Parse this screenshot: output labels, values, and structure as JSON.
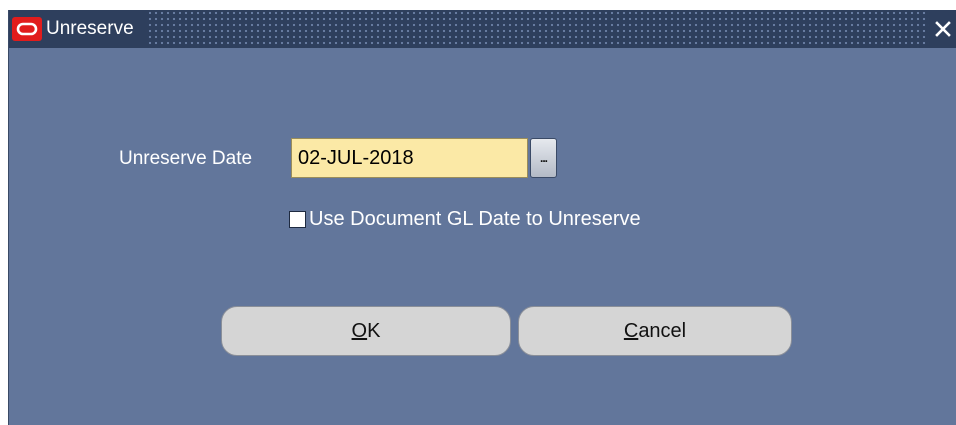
{
  "window": {
    "title": "Unreserve"
  },
  "form": {
    "unreserve_date_label": "Unreserve Date",
    "unreserve_date_value": "02-JUL-2018",
    "lov_button_label": "...",
    "use_gl_date_checked": false,
    "use_gl_date_label": "Use Document GL Date to Unreserve"
  },
  "buttons": {
    "ok": {
      "mnemonic": "O",
      "rest": "K"
    },
    "cancel": {
      "mnemonic": "C",
      "rest": "ancel"
    }
  },
  "colors": {
    "window_bg": "#62769b",
    "titlebar_bg": "#2e3f5d",
    "app_icon": "#e11c1c",
    "input_bg": "#fbe9a6",
    "button_bg": "#d5d5d5"
  },
  "icons": {
    "app": "oracle-icon",
    "close": "close-icon",
    "lov": "ellipsis-icon"
  }
}
